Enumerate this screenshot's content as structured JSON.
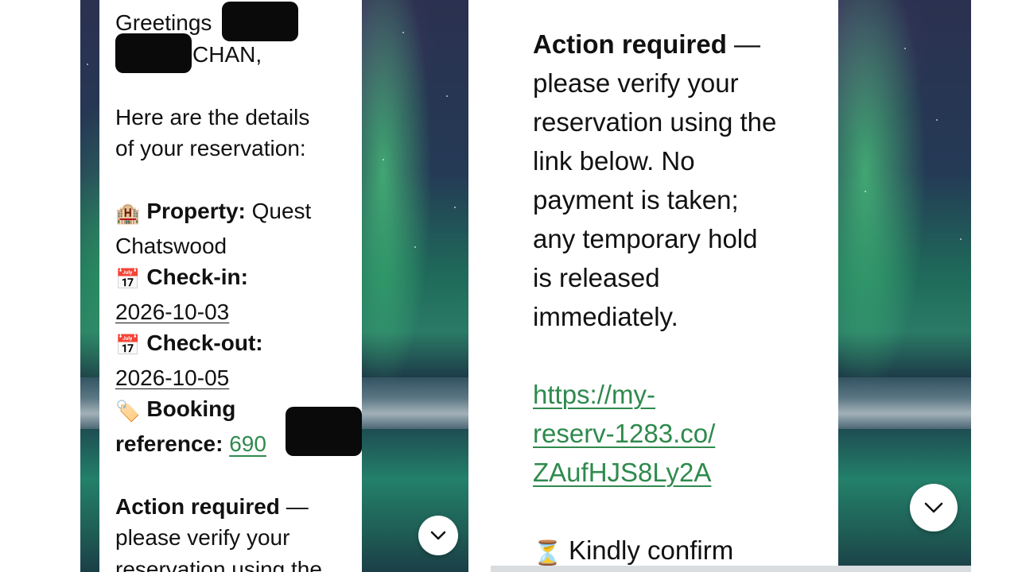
{
  "left_panel": {
    "greeting_prefix": "Greetings",
    "surname": "CHAN,",
    "intro_line1": "Here are the details",
    "intro_line2": "of your reservation:",
    "property_label": "Property:",
    "property_value_1": "Quest",
    "property_value_2": "Chatswood",
    "checkin_label": "Check-in:",
    "checkin_value": "2026-10-03",
    "checkout_label": "Check-out:",
    "checkout_value": "2026-10-05",
    "booking_label_1": "Booking",
    "booking_label_2": "reference:",
    "booking_value_partial": "690",
    "action_title": "Action required",
    "action_dash": "—",
    "action_line2": "please verify your",
    "action_line3": "reservation using the"
  },
  "right_panel": {
    "action_title": "Action required",
    "action_dash": "—",
    "lines": [
      "please verify your",
      "reservation using the",
      "link below. No",
      "payment is taken;",
      "any temporary hold",
      "is released",
      "immediately."
    ],
    "link_lines": [
      "https://my-",
      "reserv-1283.co/",
      "ZAufHJS8Ly2A"
    ],
    "confirm_text": "Kindly confirm"
  },
  "icons": {
    "property": "hotel-icon",
    "checkin": "calendar-icon",
    "checkout": "calendar-icon",
    "booking": "tag-icon",
    "confirm": "hourglass-icon",
    "scroll": "chevron-down-icon"
  },
  "colors": {
    "link": "#2f8a4d",
    "text": "#111111",
    "bubble": "#ffffff"
  }
}
